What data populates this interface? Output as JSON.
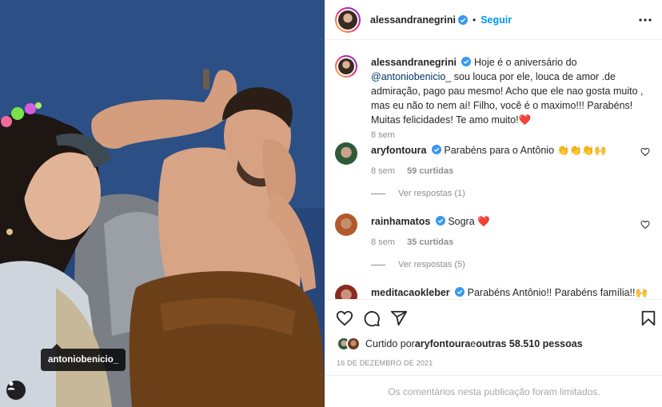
{
  "photo": {
    "tag_label": "antoniobenicio_",
    "user_tag_icon": "user-icon"
  },
  "header": {
    "username": "alessandranegrini",
    "separator": "•",
    "follow_label": "Seguir",
    "more_icon": "more-options-icon"
  },
  "caption": {
    "username": "alessandranegrini",
    "text_before": "Hoje é o aniversário do ",
    "mention": "@antoniobenicio_",
    "text_after": " sou louca por ele, louca de amor .de admiração, pago pau mesmo! Acho que ele nao gosta muito , mas eu não to nem aí! Filho, você é o maximo!!! Parabéns! Muitas felicidades! Te amo muito!",
    "emoji": "❤️",
    "time": "8 sem"
  },
  "comments": [
    {
      "username": "aryfontoura",
      "text": "Parabéns para o Antônio ",
      "emoji": "👏👏👏🙌",
      "time": "8 sem",
      "likes": "59 curtidas",
      "replies": "Ver respostas (1)"
    },
    {
      "username": "rainhamatos",
      "text": "Sogra ",
      "emoji": "❤️",
      "time": "8 sem",
      "likes": "35 curtidas",
      "replies": "Ver respostas (5)"
    },
    {
      "username": "meditacaokleber",
      "text": "Parabéns Antônio!! Parabéns família!!",
      "emoji": "🙌"
    }
  ],
  "actions": {
    "like_icon": "heart-icon",
    "comment_icon": "comment-icon",
    "share_icon": "share-icon",
    "save_icon": "bookmark-icon"
  },
  "likes": {
    "prefix": "Curtido por ",
    "user": "aryfontoura",
    "middle": " e ",
    "others": "outras 58.510 pessoas"
  },
  "date": "16 DE DEZEMBRO DE 2021",
  "comments_limited": "Os comentários nesta publicação foram limitados.",
  "colors": {
    "accent": "#0095f6",
    "verified": "#3897f0",
    "text": "#262626",
    "secondary": "#8e8e8e",
    "heart": "#ed4956"
  }
}
